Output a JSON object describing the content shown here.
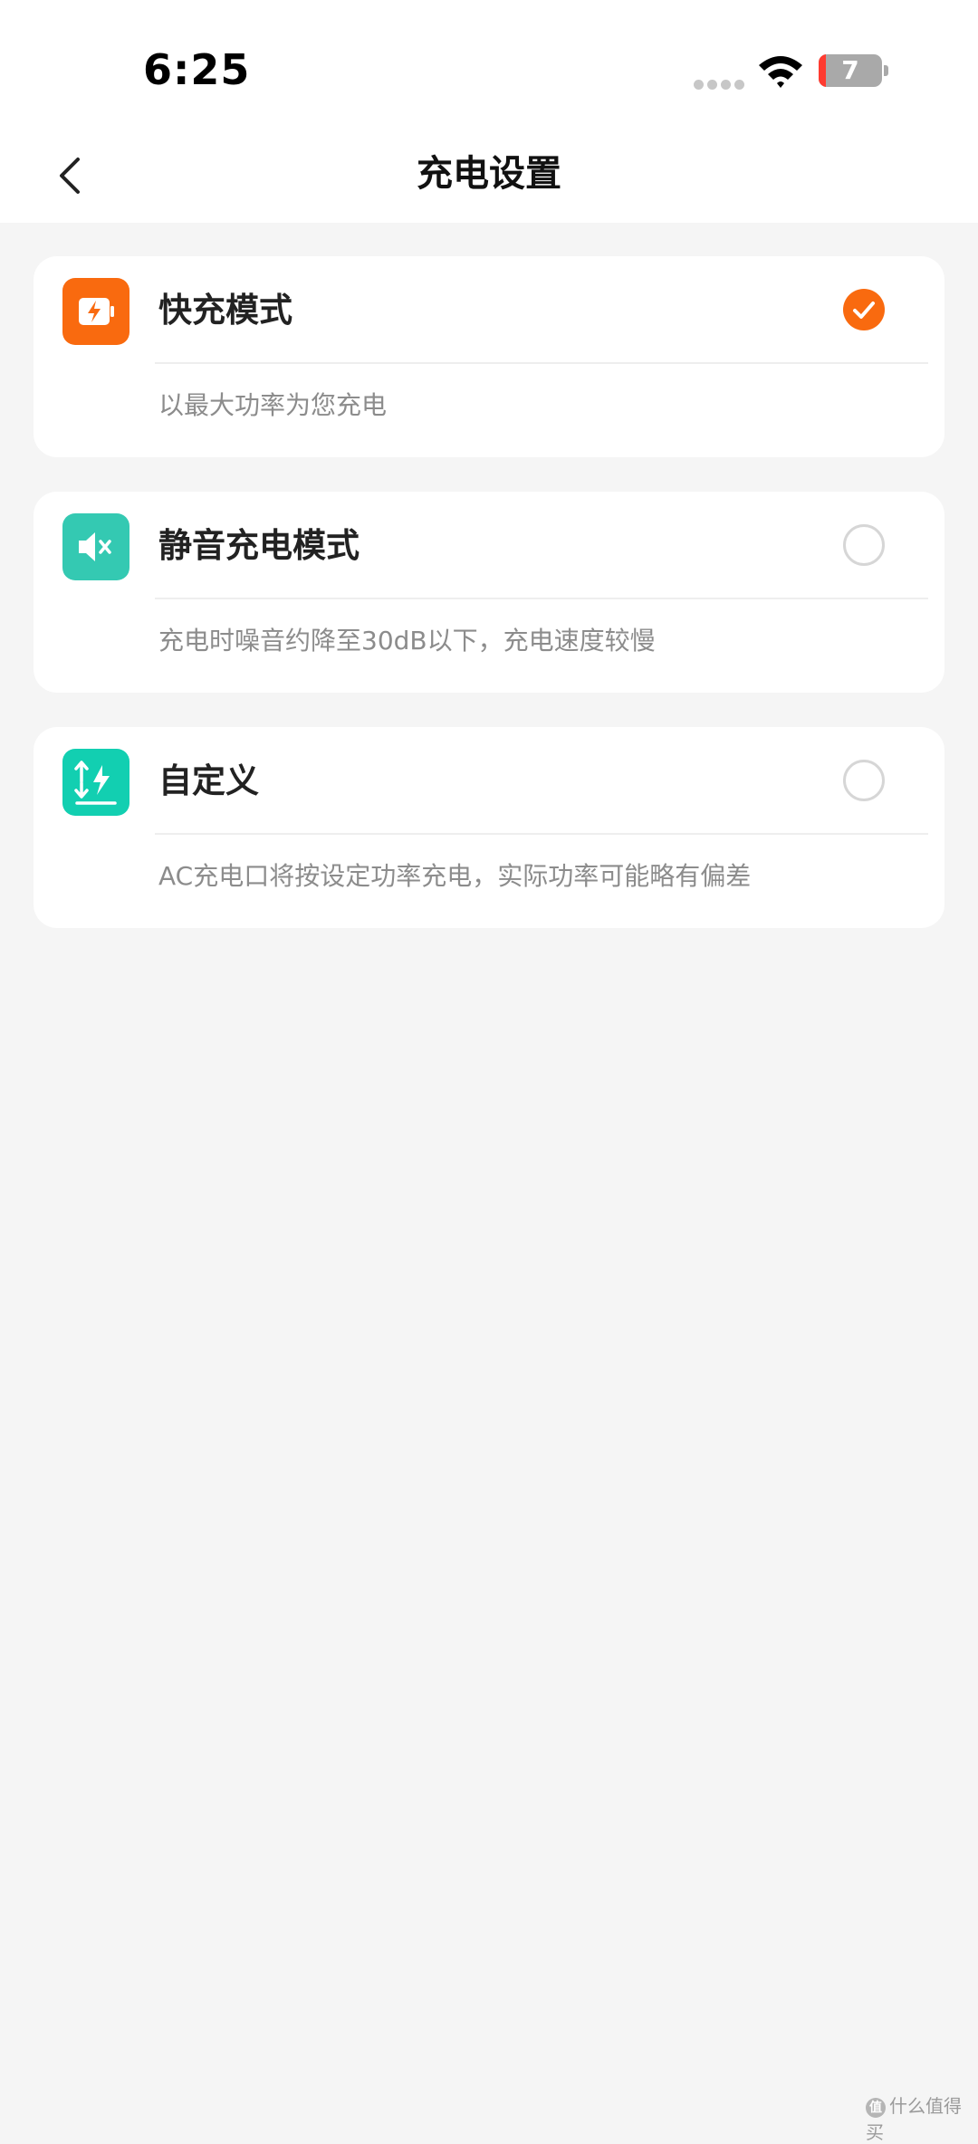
{
  "status_bar": {
    "time": "6:25",
    "battery_level": "7",
    "battery_color": "#a9a9a9",
    "battery_low_color": "#ff3b30",
    "signal_icon": "signal-dots-icon",
    "wifi_icon": "wifi-icon"
  },
  "nav": {
    "back_icon": "chevron-left-icon",
    "title": "充电设置"
  },
  "options": [
    {
      "title": "快充模式",
      "description": "以最大功率为您充电",
      "icon": "fast-charge-battery-icon",
      "icon_color": "#f96a0f",
      "selected": true
    },
    {
      "title": "静音充电模式",
      "description": "充电时噪音约降至30dB以下，充电速度较慢",
      "icon": "mute-speaker-icon",
      "icon_color": "#34c9b2",
      "selected": false
    },
    {
      "title": "自定义",
      "description": "AC充电口将按设定功率充电，实际功率可能略有偏差",
      "icon": "custom-power-icon",
      "icon_color": "#12cfb1",
      "selected": false
    }
  ],
  "accent_color": "#f96a0f",
  "watermark": {
    "badge": "值",
    "text": "什么值得买"
  }
}
